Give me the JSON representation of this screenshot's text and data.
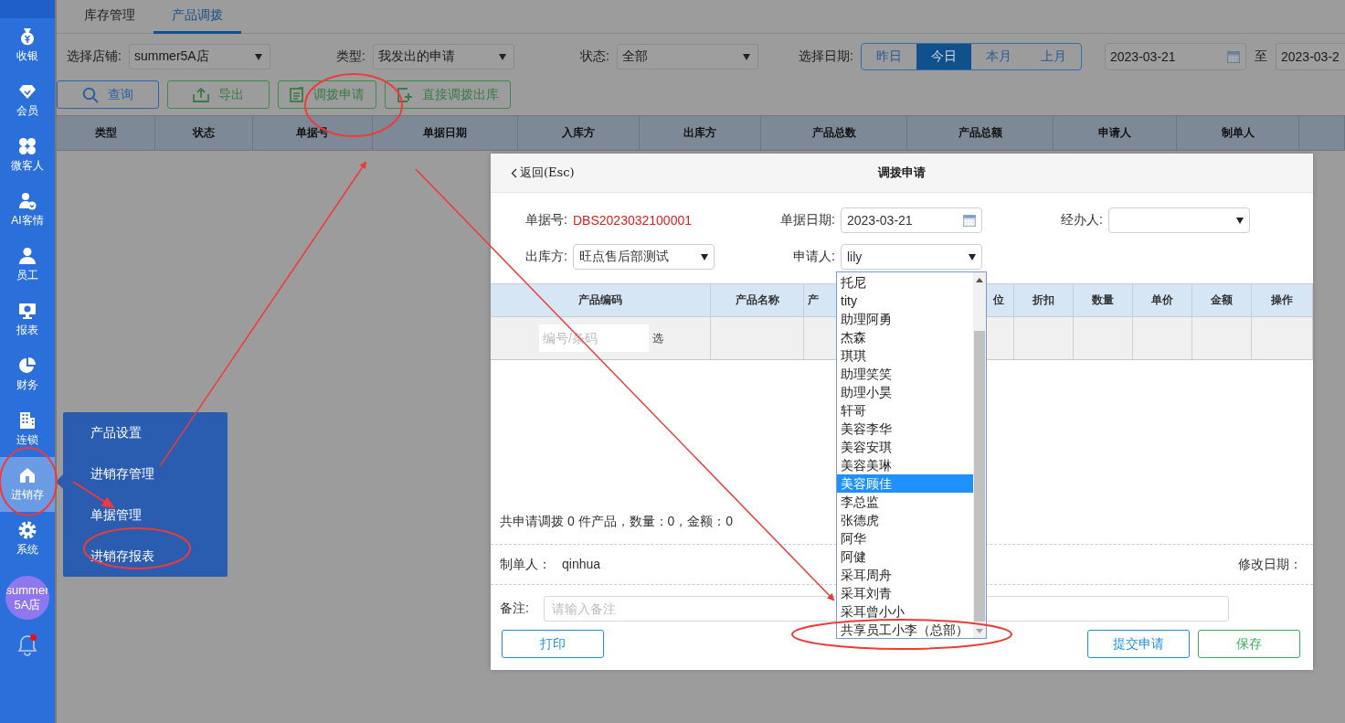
{
  "sidebar": {
    "items": [
      {
        "label": "收银",
        "selected": false
      },
      {
        "label": "会员",
        "selected": false
      },
      {
        "label": "微客人",
        "selected": false
      },
      {
        "label": "AI客情",
        "selected": false
      },
      {
        "label": "员工",
        "selected": false
      },
      {
        "label": "报表",
        "selected": false
      },
      {
        "label": "财务",
        "selected": false
      },
      {
        "label": "连锁",
        "selected": false
      },
      {
        "label": "进销存",
        "selected": true
      },
      {
        "label": "系统",
        "selected": false
      }
    ],
    "store_avatar": "summer5A店",
    "notifications": {
      "unread": true
    }
  },
  "flyout_menu": {
    "items": [
      "产品设置",
      "进销存管理",
      "单据管理",
      "进销存报表"
    ]
  },
  "tabs": [
    {
      "label": "库存管理",
      "selected": false
    },
    {
      "label": "产品调拨",
      "selected": true
    }
  ],
  "filters": {
    "store": {
      "label": "选择店铺:",
      "value": "summer5A店"
    },
    "type": {
      "label": "类型:",
      "value": "我发出的申请"
    },
    "status": {
      "label": "状态:",
      "value": "全部"
    },
    "date": {
      "label": "选择日期:",
      "presets": [
        {
          "label": "昨日",
          "selected": false
        },
        {
          "label": "今日",
          "selected": true
        },
        {
          "label": "本月",
          "selected": false
        },
        {
          "label": "上月",
          "selected": false
        }
      ],
      "from": "2023-03-21",
      "separator": "至",
      "to": "2023-03-2"
    }
  },
  "actions": [
    {
      "label": "查询",
      "kind": "primary"
    },
    {
      "label": "导出",
      "kind": "success"
    },
    {
      "label": "调拨申请",
      "kind": "success"
    },
    {
      "label": "直接调拨出库",
      "kind": "success"
    }
  ],
  "table": {
    "columns": [
      "类型",
      "状态",
      "单据号",
      "单据日期",
      "入库方",
      "出库方",
      "产品总数",
      "产品总额",
      "申请人",
      "制单人"
    ]
  },
  "dialog": {
    "back": "返回(Esc)",
    "title": "调拨申请",
    "fields": [
      {
        "label": "单据号:",
        "value": "DBS2023032100001",
        "kind": "text"
      },
      {
        "label": "单据日期:",
        "value": "2023-03-21",
        "kind": "date"
      },
      {
        "label": "经办人:",
        "kind": "select"
      },
      {
        "label": "出库方:",
        "value": "旺点售后部测试",
        "kind": "select"
      },
      {
        "label": "申请人:",
        "value": "lily",
        "kind": "select"
      }
    ],
    "items_table": {
      "columns": [
        "产品编码",
        "产品名称",
        "产",
        "位",
        "折扣",
        "数量",
        "单价",
        "金额",
        "操作"
      ],
      "code_placeholder": "编号/条码",
      "pick": "选"
    },
    "summary": "共申请调拨 0 件产品，数量：0，金额：0",
    "creator": {
      "label": "制单人：",
      "value": "qinhua"
    },
    "modified": {
      "label": "修改日期："
    },
    "remark": {
      "label": "备注:",
      "placeholder": "请输入备注"
    },
    "buttons": [
      {
        "label": "打印",
        "kind": "default"
      },
      {
        "label": "提交申请",
        "kind": "primary"
      },
      {
        "label": "保存",
        "kind": "success"
      }
    ]
  },
  "applicant_options": [
    {
      "label": "托尼",
      "selected": false
    },
    {
      "label": "tity",
      "selected": false
    },
    {
      "label": "助理阿勇",
      "selected": false
    },
    {
      "label": "杰森",
      "selected": false
    },
    {
      "label": "琪琪",
      "selected": false
    },
    {
      "label": "助理笑笑",
      "selected": false
    },
    {
      "label": "助理小昊",
      "selected": false
    },
    {
      "label": "轩哥",
      "selected": false
    },
    {
      "label": "美容李华",
      "selected": false
    },
    {
      "label": "美容安琪",
      "selected": false
    },
    {
      "label": "美容美琳",
      "selected": false
    },
    {
      "label": "美容顾佳",
      "selected": true
    },
    {
      "label": "李总监",
      "selected": false
    },
    {
      "label": "张德虎",
      "selected": false
    },
    {
      "label": "阿华",
      "selected": false
    },
    {
      "label": "阿健",
      "selected": false
    },
    {
      "label": "采耳周舟",
      "selected": false
    },
    {
      "label": "采耳刘青",
      "selected": false
    },
    {
      "label": "采耳曾小小",
      "selected": false
    },
    {
      "label": "共享员工小李（总部）",
      "selected": false
    }
  ]
}
